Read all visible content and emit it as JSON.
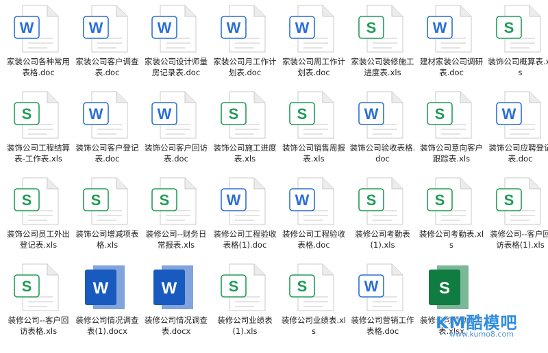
{
  "files": [
    {
      "name": "家装公司各种常用表格.doc",
      "type": "doc"
    },
    {
      "name": "家装公司客户调查表.doc",
      "type": "doc"
    },
    {
      "name": "家装公司设计师量房记录表.doc",
      "type": "doc"
    },
    {
      "name": "家装公司月工作计划表.doc",
      "type": "doc"
    },
    {
      "name": "家装公司周工作计划表.doc",
      "type": "doc"
    },
    {
      "name": "家装公司装修施工进度表.xls",
      "type": "xls"
    },
    {
      "name": "建材家装公司调研表.doc",
      "type": "doc"
    },
    {
      "name": "装饰公司概算表.xls",
      "type": "xls"
    },
    {
      "name": "装饰公司工程结算表-工作表.xls",
      "type": "xls"
    },
    {
      "name": "装饰公司客户登记表.doc",
      "type": "doc"
    },
    {
      "name": "装饰公司客户回访表.doc",
      "type": "doc"
    },
    {
      "name": "装饰公司施工进度表.xls",
      "type": "xls"
    },
    {
      "name": "装饰公司销售周报表.xls",
      "type": "xls"
    },
    {
      "name": "装饰公司验收表格.doc",
      "type": "doc"
    },
    {
      "name": "装饰公司意向客户跟踪表.xls",
      "type": "xls"
    },
    {
      "name": "装饰公司应聘登记表.doc",
      "type": "doc"
    },
    {
      "name": "装饰公司员工外出登记表.xls",
      "type": "xls"
    },
    {
      "name": "装饰公司增减项表格.xls",
      "type": "xls"
    },
    {
      "name": "装修公司--财务日常报表.xls",
      "type": "xls"
    },
    {
      "name": "装修公司工程验收表格(1).doc",
      "type": "doc"
    },
    {
      "name": "装修公司工程验收表格.doc",
      "type": "doc"
    },
    {
      "name": "装修公司考勤表(1).xls",
      "type": "xls"
    },
    {
      "name": "装修公司考勤表.xls",
      "type": "xls"
    },
    {
      "name": "装修公司--客户回访表格(1).xls",
      "type": "xls"
    },
    {
      "name": "装修公司--客户回访表格.xls",
      "type": "xls"
    },
    {
      "name": "装修公司情况调查表(1).docx",
      "type": "docx"
    },
    {
      "name": "装修公司情况调查表.docx",
      "type": "docx"
    },
    {
      "name": "装修公司业绩表(1).xls",
      "type": "xls"
    },
    {
      "name": "装修公司业绩表.xls",
      "type": "xls"
    },
    {
      "name": "装修公司营销工作表格.doc",
      "type": "doc"
    },
    {
      "name": "装修公司预算详情表.xlsx",
      "type": "xlsx"
    }
  ],
  "watermark": {
    "title": "KM酷模吧",
    "url": "www.kumo8.com"
  },
  "colors": {
    "word_blue": "#2b6fd6",
    "excel_green": "#1f9d55",
    "modern_word": "#185abd",
    "modern_excel": "#107c41"
  }
}
